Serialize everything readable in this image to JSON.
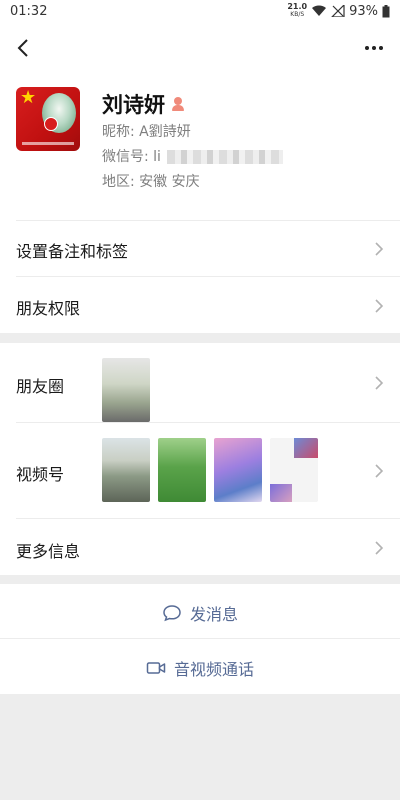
{
  "status_bar": {
    "time": "01:32",
    "net_speed_value": "21.0",
    "net_speed_unit": "KB/S",
    "battery": "93%"
  },
  "profile": {
    "name": "刘诗妍",
    "nickname_label": "昵称:",
    "nickname": "A劉詩妍",
    "wechat_id_label": "微信号:",
    "wechat_id_visible": "li",
    "region_label": "地区:",
    "region": "安徽  安庆"
  },
  "menu": {
    "remarks_tags": "设置备注和标签",
    "friend_permissions": "朋友权限",
    "moments": "朋友圈",
    "channels": "视频号",
    "more_info": "更多信息"
  },
  "actions": {
    "send_message": "发消息",
    "video_call": "音视频通话"
  },
  "colors": {
    "accent_link": "#576b95",
    "background": "#ededed",
    "gender_female": "#f08a7a",
    "avatar_red": "#d81e1e"
  },
  "icons": {
    "back": "back-arrow-icon",
    "more": "more-dots-icon",
    "gender": "female-icon",
    "chevron": "chevron-right-icon",
    "message": "chat-bubble-icon",
    "video": "video-camera-icon"
  }
}
